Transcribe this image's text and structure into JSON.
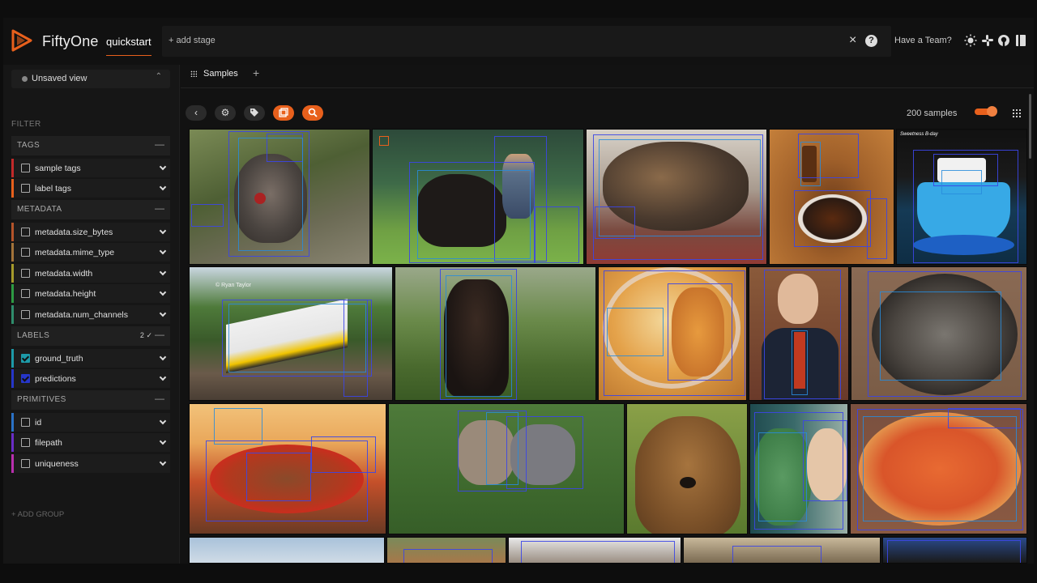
{
  "header": {
    "app_title": "FiftyOne",
    "dataset_name": "quickstart",
    "add_stage_label": "+ add stage",
    "close_symbol": "×",
    "help_symbol": "?",
    "team_button_label": "Have a Team?"
  },
  "sidebar": {
    "view_selector_label": "Unsaved view",
    "filter_heading": "FILTER",
    "add_group_label": "+ ADD GROUP",
    "groups": [
      {
        "label": "TAGS"
      },
      {
        "label": "METADATA"
      },
      {
        "label": "LABELS",
        "count": "2"
      },
      {
        "label": "PRIMITIVES"
      }
    ],
    "fields": [
      {
        "label": "sample tags",
        "color": "#c32a2a",
        "checked": false
      },
      {
        "label": "label tags",
        "color": "#e8601c",
        "checked": false
      },
      {
        "label": "metadata.size_bytes",
        "color": "#b5542a",
        "checked": false
      },
      {
        "label": "metadata.mime_type",
        "color": "#a3733a",
        "checked": false
      },
      {
        "label": "metadata.width",
        "color": "#a59a2b",
        "checked": false
      },
      {
        "label": "metadata.height",
        "color": "#2d9b43",
        "checked": false
      },
      {
        "label": "metadata.num_channels",
        "color": "#2f8d6c",
        "checked": false
      },
      {
        "label": "ground_truth",
        "color": "#1d9aa8",
        "checked": true
      },
      {
        "label": "predictions",
        "color": "#2636c9",
        "checked": true
      },
      {
        "label": "id",
        "color": "#2a72c7",
        "checked": false
      },
      {
        "label": "filepath",
        "color": "#6a2dc7",
        "checked": false
      },
      {
        "label": "uniqueness",
        "color": "#b92fae",
        "checked": false
      }
    ]
  },
  "main": {
    "tab_label": "Samples",
    "tab_add": "+",
    "samples_count": "200 samples",
    "toolbar_icons": [
      "back-icon",
      "settings-icon",
      "tag-icon",
      "patches-icon",
      "search-icon"
    ]
  },
  "grid": {
    "train_watermark": "© Ryan Taylor",
    "cake_caption": "Sweetness B-day"
  },
  "colors": {
    "accent": "#e8601c",
    "prediction_box": "#3c46e6",
    "ground_truth_box": "#288cdc"
  }
}
